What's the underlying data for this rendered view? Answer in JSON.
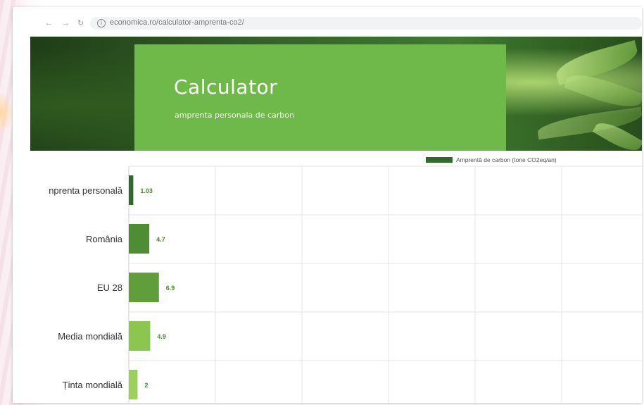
{
  "browser": {
    "url": "economica.ro/calculator-amprenta-co2/"
  },
  "hero": {
    "title": "Calculator",
    "subtitle": "amprenta personala de carbon"
  },
  "chart_data": {
    "type": "bar",
    "orientation": "horizontal",
    "categories": [
      "nprenta personală",
      "România",
      "EU 28",
      "Media mondială",
      "Ținta mondială"
    ],
    "values": [
      1.03,
      4.7,
      6.9,
      4.9,
      2
    ],
    "value_labels": [
      "1.03",
      "4.7",
      "6.9",
      "4.9",
      "2"
    ],
    "series": [
      {
        "name": "Amprentă de carbon (tone CO2eq/an)",
        "values": [
          1.03,
          4.7,
          6.9,
          4.9,
          2
        ]
      }
    ],
    "colors": [
      "#2e6b2a",
      "#4f8d35",
      "#5f9e3b",
      "#8cc64f",
      "#9bd05a"
    ],
    "label_color": "#4a8a2e",
    "legend_position": "top-right",
    "grid": true
  },
  "colors": {
    "hero_card": "#6fb84a",
    "legend_swatch": "#2e6b2a"
  }
}
